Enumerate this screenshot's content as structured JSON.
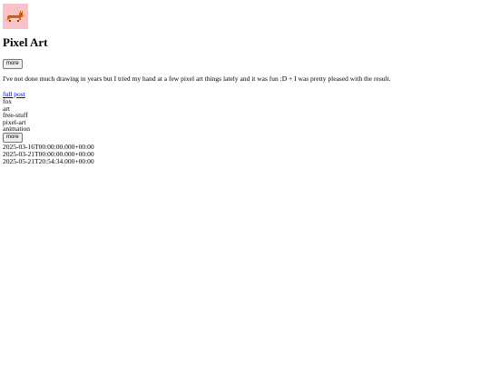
{
  "post": {
    "thumbnail_icon": "pixel-fox-icon",
    "thumbnail_bg": "#f7c3c8",
    "title": "Pixel Art",
    "more_label": "more",
    "excerpt": "I've not done much drawing in years but I tried my hand at a few pixel art things lately and it was fun :D + I was pretty pleased with the result.",
    "full_post_label": "full post",
    "tags": [
      "fox",
      "art",
      "free-stuff",
      "pixel-art",
      "animation"
    ],
    "more_label_2": "more",
    "dates": [
      "2025-03-16T00:00:00.000+00:00",
      "2025-03-21T00:00:00.000+00:00",
      "2025-05-21T20:54:34.000+00:00"
    ]
  }
}
